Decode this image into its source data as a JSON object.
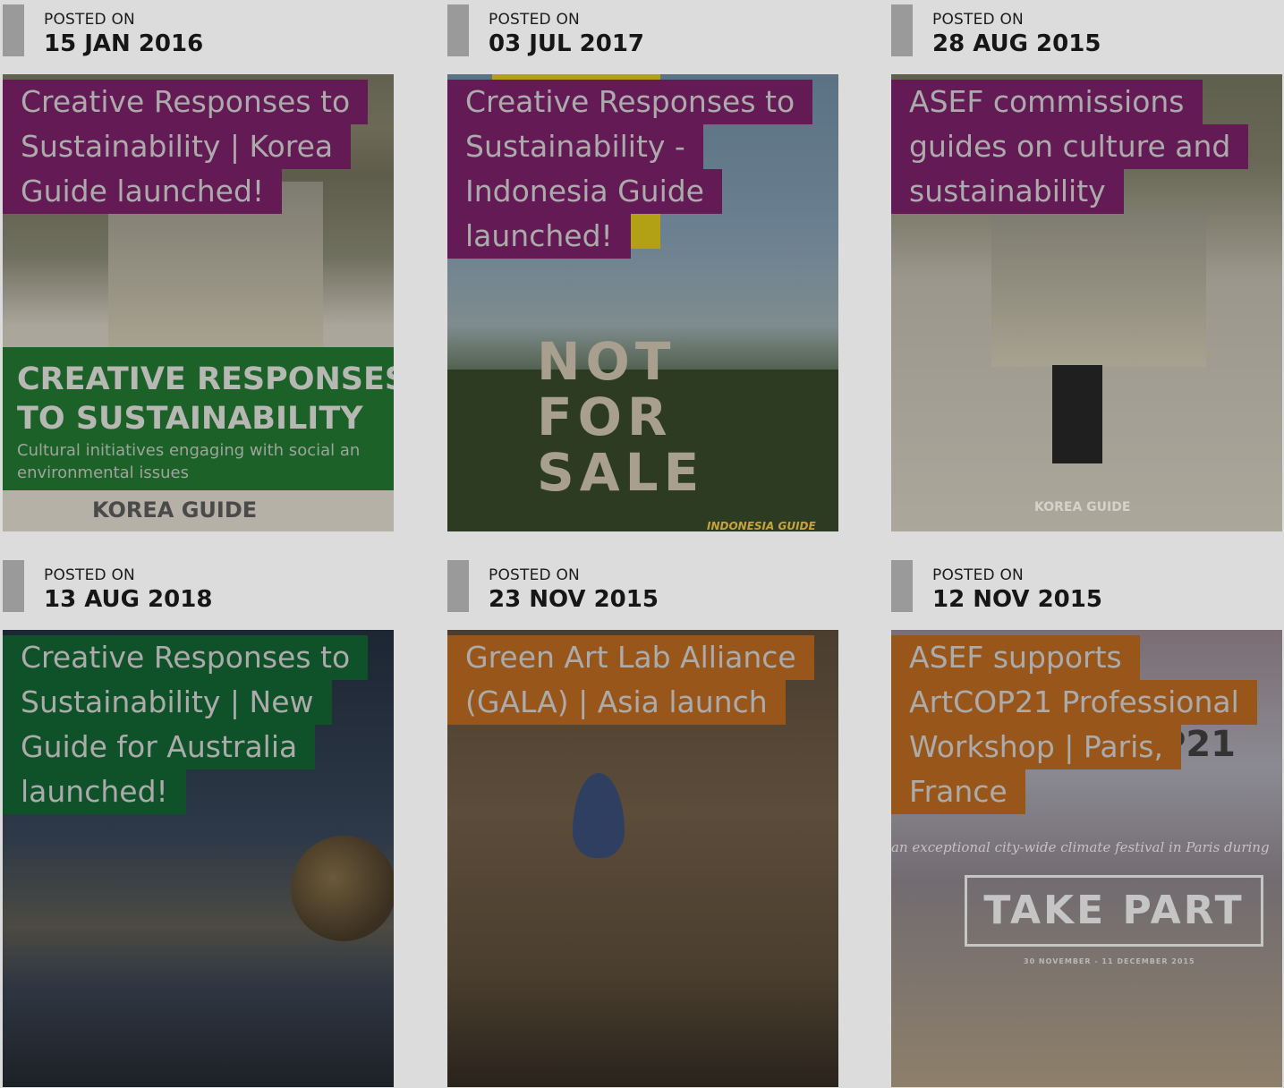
{
  "posted_label": "POSTED ON",
  "cards": [
    {
      "date": "15 JAN 2016",
      "title_lines": [
        "Creative Responses to",
        "Sustainability | Korea",
        "Guide launched!"
      ],
      "title_color": "#641a55",
      "image": {
        "banner_title_1": "CREATIVE RESPONSES",
        "banner_title_2": "TO SUSTAINABILITY",
        "banner_sub_1": "Cultural initiatives engaging with social an",
        "banner_sub_2": "environmental issues",
        "footer": "KOREA GUIDE"
      }
    },
    {
      "date": "03 JUL 2017",
      "title_lines": [
        "Creative Responses to",
        "Sustainability -",
        "Indonesia Guide",
        "launched!"
      ],
      "title_color": "#641a55",
      "image": {
        "sign_text": "NOT FOR SALE",
        "caption": "INDONESIA GUIDE"
      }
    },
    {
      "date": "28 AUG 2015",
      "title_lines": [
        "ASEF commissions",
        "guides on culture and",
        "sustainability"
      ],
      "title_color": "#641a55",
      "image": {
        "caption": "KOREA GUIDE"
      }
    },
    {
      "date": "13 AUG 2018",
      "title_lines": [
        "Creative Responses to",
        "Sustainability | New",
        "Guide for Australia",
        "launched!"
      ],
      "title_color": "#0f5129",
      "image": {}
    },
    {
      "date": "23 NOV 2015",
      "title_lines": [
        "Green Art Lab Alliance",
        "(GALA) | Asia launch"
      ],
      "title_color": "#99561b",
      "image": {}
    },
    {
      "date": "12 NOV 2015",
      "title_lines": [
        "ASEF supports",
        "ArtCOP21 Professional",
        "Workshop | Paris,",
        "France"
      ],
      "title_color": "#99561b",
      "image": {
        "tagline": "an exceptional city-wide climate festival in Paris during",
        "button": "TAKE PART",
        "dates": "30 NOVEMBER - 11 DECEMBER 2015",
        "logo_fragment": "P21"
      }
    }
  ]
}
